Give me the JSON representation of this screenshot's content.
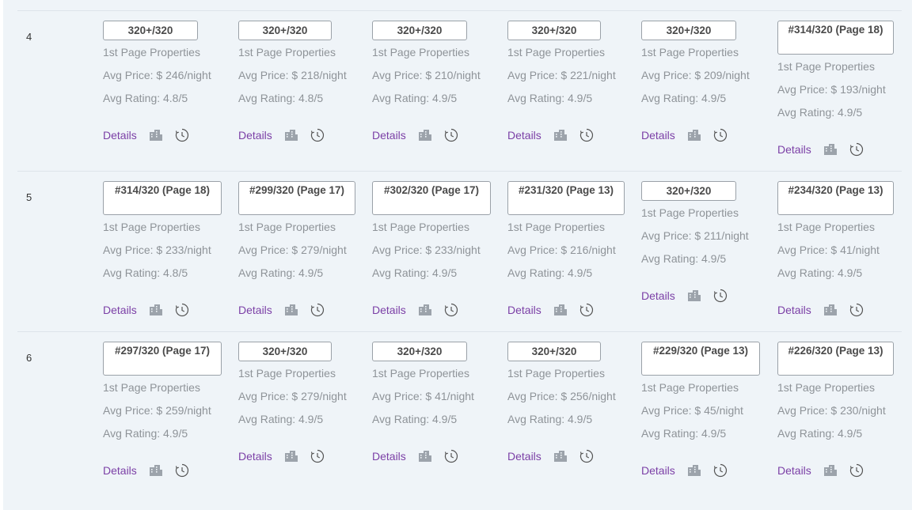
{
  "rows": [
    {
      "rank": "4",
      "cells": [
        {
          "badge": "320+/320",
          "props": "1st Page Properties",
          "price": "Avg Price: $ 246/night",
          "rating": "Avg Rating: 4.8/5"
        },
        {
          "badge": "320+/320",
          "props": "1st Page Properties",
          "price": "Avg Price: $ 218/night",
          "rating": "Avg Rating: 4.8/5"
        },
        {
          "badge": "320+/320",
          "props": "1st Page Properties",
          "price": "Avg Price: $ 210/night",
          "rating": "Avg Rating: 4.9/5"
        },
        {
          "badge": "320+/320",
          "props": "1st Page Properties",
          "price": "Avg Price: $ 221/night",
          "rating": "Avg Rating: 4.9/5"
        },
        {
          "badge": "320+/320",
          "props": "1st Page Properties",
          "price": "Avg Price: $ 209/night",
          "rating": "Avg Rating: 4.9/5"
        },
        {
          "badge": "#314/320 (Page 18)",
          "props": "1st Page Properties",
          "price": "Avg Price: $ 193/night",
          "rating": "Avg Rating: 4.9/5"
        }
      ]
    },
    {
      "rank": "5",
      "cells": [
        {
          "badge": "#314/320 (Page 18)",
          "props": "1st Page Properties",
          "price": "Avg Price: $ 233/night",
          "rating": "Avg Rating: 4.8/5"
        },
        {
          "badge": "#299/320 (Page 17)",
          "props": "1st Page Properties",
          "price": "Avg Price: $ 279/night",
          "rating": "Avg Rating: 4.9/5"
        },
        {
          "badge": "#302/320 (Page 17)",
          "props": "1st Page Properties",
          "price": "Avg Price: $ 233/night",
          "rating": "Avg Rating: 4.9/5"
        },
        {
          "badge": "#231/320 (Page 13)",
          "props": "1st Page Properties",
          "price": "Avg Price: $ 216/night",
          "rating": "Avg Rating: 4.9/5"
        },
        {
          "badge": "320+/320",
          "props": "1st Page Properties",
          "price": "Avg Price: $ 211/night",
          "rating": "Avg Rating: 4.9/5"
        },
        {
          "badge": "#234/320 (Page 13)",
          "props": "1st Page Properties",
          "price": "Avg Price: $ 41/night",
          "rating": "Avg Rating: 4.9/5"
        }
      ]
    },
    {
      "rank": "6",
      "cells": [
        {
          "badge": "#297/320 (Page 17)",
          "props": "1st Page Properties",
          "price": "Avg Price: $ 259/night",
          "rating": "Avg Rating: 4.9/5"
        },
        {
          "badge": "320+/320",
          "props": "1st Page Properties",
          "price": "Avg Price: $ 279/night",
          "rating": "Avg Rating: 4.9/5"
        },
        {
          "badge": "320+/320",
          "props": "1st Page Properties",
          "price": "Avg Price: $ 41/night",
          "rating": "Avg Rating: 4.9/5"
        },
        {
          "badge": "320+/320",
          "props": "1st Page Properties",
          "price": "Avg Price: $ 256/night",
          "rating": "Avg Rating: 4.9/5"
        },
        {
          "badge": "#229/320 (Page 13)",
          "props": "1st Page Properties",
          "price": "Avg Price: $ 45/night",
          "rating": "Avg Rating: 4.9/5"
        },
        {
          "badge": "#226/320 (Page 13)",
          "props": "1st Page Properties",
          "price": "Avg Price: $ 230/night",
          "rating": "Avg Rating: 4.9/5"
        }
      ]
    }
  ],
  "labels": {
    "details": "Details"
  },
  "icons": {
    "listings": "building-icon",
    "history": "history-clock-icon"
  },
  "colors": {
    "link": "#7b3fa6",
    "muted_text": "#8e9398",
    "panel_bg": "#eff4f8"
  }
}
